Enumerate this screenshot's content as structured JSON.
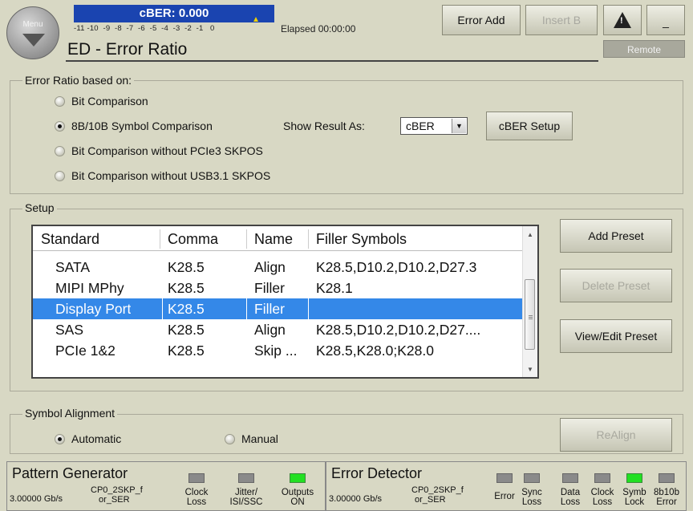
{
  "header": {
    "menu_label": "Menu",
    "cber_readout": "cBER: 0.000",
    "scale_ticks": "-11 -10  -9  -8  -7  -6  -5  -4  -3  -2  -1   0",
    "elapsed": "Elapsed 00:00:00",
    "title": "ED - Error Ratio",
    "error_add": "Error Add",
    "insert_b": "Insert B",
    "minimize": "_",
    "remote": "Remote"
  },
  "error_ratio": {
    "legend": "Error Ratio based on:",
    "options": [
      {
        "label": "Bit Comparison",
        "selected": false
      },
      {
        "label": "8B/10B Symbol Comparison",
        "selected": true
      },
      {
        "label": "Bit Comparison without PCIe3 SKPOS",
        "selected": false
      },
      {
        "label": "Bit Comparison without USB3.1 SKPOS",
        "selected": false
      }
    ],
    "show_result_label": "Show Result As:",
    "show_result_value": "cBER",
    "cber_setup": "cBER Setup"
  },
  "setup": {
    "legend": "Setup",
    "columns": [
      "Standard",
      "Comma",
      "Name",
      "Filler Symbols"
    ],
    "rows": [
      [
        "SATA",
        "K28.5",
        "Align",
        "K28.5,D10.2,D10.2,D27.3"
      ],
      [
        "MIPI MPhy",
        "K28.5",
        "Filler",
        "K28.1"
      ],
      [
        "Display Port",
        "K28.5",
        "Filler",
        ""
      ],
      [
        "SAS",
        "K28.5",
        "Align",
        "K28.5,D10.2,D10.2,D27...."
      ],
      [
        "PCIe 1&2",
        "K28.5",
        "Skip ...",
        "K28.5,K28.0;K28.0"
      ]
    ],
    "selected_row": 2,
    "add_preset": "Add Preset",
    "delete_preset": "Delete Preset",
    "view_edit_preset": "View/Edit Preset"
  },
  "symbol_alignment": {
    "legend": "Symbol Alignment",
    "automatic": "Automatic",
    "manual": "Manual",
    "selected": "automatic",
    "realign": "ReAlign"
  },
  "status_bar": {
    "pg": {
      "title": "Pattern Generator",
      "rate": "3.00000 Gb/s",
      "pattern_line1": "CP0_2SKP_f",
      "pattern_line2": "or_SER",
      "leds": [
        {
          "line1": "Clock",
          "line2": "Loss",
          "on": false
        },
        {
          "line1": "Jitter/",
          "line2": "ISI/SSC",
          "on": false
        },
        {
          "line1": "Outputs",
          "line2": "ON",
          "on": true
        }
      ]
    },
    "ed": {
      "title": "Error Detector",
      "rate": "3.00000 Gb/s",
      "pattern_line1": "CP0_2SKP_f",
      "pattern_line2": "or_SER",
      "leds": [
        {
          "line1": "Error",
          "line2": "",
          "on": false
        },
        {
          "line1": "Sync",
          "line2": "Loss",
          "on": false
        },
        {
          "line1": "Data",
          "line2": "Loss",
          "on": false
        },
        {
          "line1": "Clock",
          "line2": "Loss",
          "on": false
        },
        {
          "line1": "Symb",
          "line2": "Lock",
          "on": true
        },
        {
          "line1": "8b10b",
          "line2": "Error",
          "on": false
        }
      ]
    }
  },
  "colors": {
    "background": "#d8d8c4",
    "readout_blue": "#1a44b0",
    "selection_blue": "#3488e8",
    "led_on": "#22e022",
    "led_off": "#8a8a8a"
  }
}
